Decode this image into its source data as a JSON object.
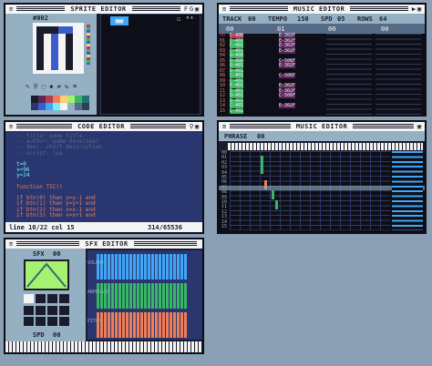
{
  "sprite": {
    "title": "SPRITE EDITOR",
    "index": "#002",
    "badges": [
      "☐",
      "ᴿ⁶"
    ],
    "palette": [
      "#1a1c2c",
      "#5d275d",
      "#b13e53",
      "#ef7d57",
      "#ffcd75",
      "#a7f070",
      "#38b764",
      "#257179",
      "#29366f",
      "#3b5dc9",
      "#41a6f6",
      "#73eff7",
      "#f4f4f4",
      "#94b0c2",
      "#566c86",
      "#333c57"
    ]
  },
  "music": {
    "title": "MUSIC EDITOR",
    "track_label": "TRACK",
    "track_val": "00",
    "tempo_label": "TEMPO",
    "tempo_val": "150",
    "spd_label": "SPD",
    "spd_val": "05",
    "rows_label": "ROWS",
    "rows_val": "64",
    "channels": [
      "00",
      "01",
      "00",
      "00"
    ],
    "rows": [
      "00",
      "01",
      "02",
      "03",
      "04",
      "05",
      "06",
      "07",
      "08",
      "09",
      "10",
      "11",
      "12",
      "13",
      "14",
      "15"
    ],
    "notes": [
      {
        "r": 0,
        "a": "C-400",
        "b": "E-302F"
      },
      {
        "r": 1,
        "a": "C-401",
        "b": "E-302F"
      },
      {
        "r": 2,
        "a": "C-401",
        "b": "E-302F"
      },
      {
        "r": 3,
        "a": "C-401",
        "b": "E-302F"
      },
      {
        "r": 4,
        "a": "D-400",
        "b": ""
      },
      {
        "r": 5,
        "a": "D-400",
        "b": "C-506F"
      },
      {
        "r": 6,
        "a": "D-401",
        "b": "E-302F"
      },
      {
        "r": 7,
        "a": "D-401",
        "b": ""
      },
      {
        "r": 8,
        "a": "C-401",
        "b": "C-506F"
      },
      {
        "r": 9,
        "a": "C-401",
        "b": ""
      },
      {
        "r": 10,
        "a": "E-401",
        "b": "E-302F"
      },
      {
        "r": 11,
        "a": "E-401",
        "b": "E-302F"
      },
      {
        "r": 12,
        "a": "D-401",
        "b": "C-506F"
      },
      {
        "r": 13,
        "a": "D-401",
        "b": ""
      },
      {
        "r": 14,
        "a": "C-401",
        "b": "E-302F"
      },
      {
        "r": 15,
        "a": "C-401",
        "b": ""
      }
    ]
  },
  "code": {
    "title": "CODE EDITOR",
    "lines": [
      {
        "t": "-- title:  game title",
        "c": "#566c86"
      },
      {
        "t": "-- author: game developer",
        "c": "#566c86"
      },
      {
        "t": "-- desc:   short description",
        "c": "#566c86"
      },
      {
        "t": "-- script: lua",
        "c": "#566c86"
      },
      {
        "t": "",
        "c": "#f4f4f4"
      },
      {
        "t": "t=0",
        "c": "#73eff7"
      },
      {
        "t": "x=96",
        "c": "#73eff7"
      },
      {
        "t": "y=24",
        "c": "#73eff7"
      },
      {
        "t": "",
        "c": "#f4f4f4"
      },
      {
        "t": "function TIC()",
        "c": "#ef7d57"
      },
      {
        "t": "",
        "c": "#f4f4f4"
      },
      {
        "t": " if btn(0) then y=y-1 end",
        "c": "#ef7d57"
      },
      {
        "t": " if btn(1) then y=y+1 end",
        "c": "#ef7d57"
      },
      {
        "t": " if btn(2) then x=x-1 end",
        "c": "#ef7d57"
      },
      {
        "t": " if btn(3) then x=x+1 end",
        "c": "#ef7d57"
      }
    ],
    "status_line": "line 10/22 col 15",
    "status_size": "314/65536"
  },
  "music2": {
    "title": "MUSIC EDITOR",
    "phrase_label": "PHRASE",
    "phrase_val": "00",
    "row_labels": [
      "00",
      "01",
      "02",
      "03",
      "04",
      "05",
      "06",
      "07",
      "08",
      "09",
      "10",
      "11",
      "12",
      "13",
      "14",
      "15"
    ]
  },
  "sfx": {
    "title": "SFX EDITOR",
    "sfx_label": "SFX",
    "sfx_val": "00",
    "spd_label": "SPD",
    "spd_val": "00",
    "labels": [
      "VOLUME",
      "ARPEGGIO",
      "PITCH"
    ]
  }
}
